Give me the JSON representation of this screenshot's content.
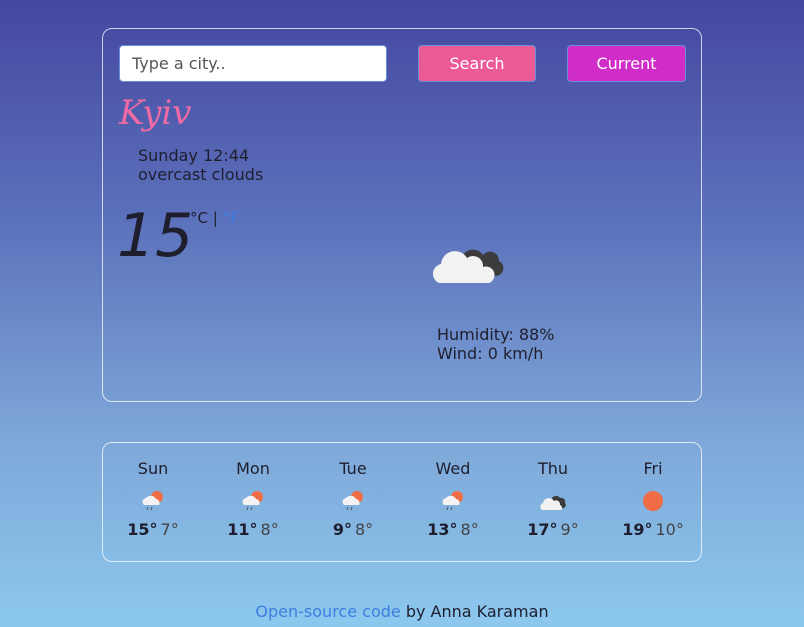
{
  "search": {
    "placeholder": "Type a city..",
    "value": ""
  },
  "buttons": {
    "search_label": "Search",
    "current_label": "Current"
  },
  "current": {
    "city": "Kyiv",
    "datetime": "Sunday 12:44",
    "description": "overcast clouds",
    "temperature": "15",
    "unit_c": "°C",
    "unit_sep": "|",
    "unit_f": "°F",
    "humidity": "Humidity: 88%",
    "wind": "Wind: 0 km/h",
    "icon": "overcast-clouds-icon"
  },
  "forecast": [
    {
      "day": "Sun",
      "max": "15°",
      "min": "7°",
      "icon": "rain-sun-icon"
    },
    {
      "day": "Mon",
      "max": "11°",
      "min": "8°",
      "icon": "rain-sun-icon"
    },
    {
      "day": "Tue",
      "max": "9°",
      "min": "8°",
      "icon": "rain-sun-icon"
    },
    {
      "day": "Wed",
      "max": "13°",
      "min": "8°",
      "icon": "rain-sun-icon"
    },
    {
      "day": "Thu",
      "max": "17°",
      "min": "9°",
      "icon": "overcast-clouds-icon"
    },
    {
      "day": "Fri",
      "max": "19°",
      "min": "10°",
      "icon": "sun-icon"
    }
  ],
  "footer": {
    "link_text": "Open-source code",
    "suffix": " by Anna Karaman"
  },
  "colors": {
    "accent_pink": "#ec5a96",
    "accent_magenta": "#d02cc8",
    "link_blue": "#3d7fe0",
    "sun_orange": "#ef6c47"
  }
}
